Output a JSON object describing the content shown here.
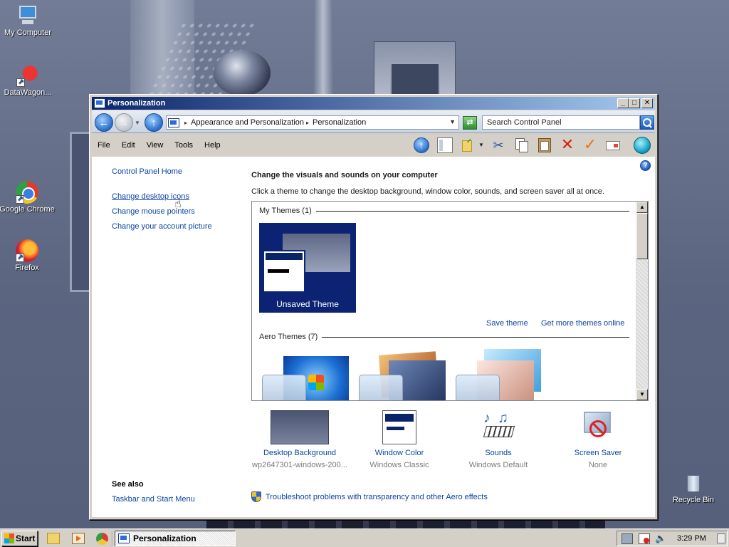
{
  "desktop": {
    "icons": [
      {
        "label": "My Computer"
      },
      {
        "label": "DataWagon..."
      },
      {
        "label": "Google Chrome"
      },
      {
        "label": "Firefox"
      },
      {
        "label": "Recycle Bin"
      }
    ]
  },
  "window": {
    "title": "Personalization",
    "address": {
      "breadcrumbs": [
        "Appearance and Personalization",
        "Personalization"
      ],
      "search_placeholder": "Search Control Panel"
    },
    "menu": [
      "File",
      "Edit",
      "View",
      "Tools",
      "Help"
    ],
    "left_nav": {
      "links": [
        "Control Panel Home",
        "Change desktop icons",
        "Change mouse pointers",
        "Change your account picture"
      ],
      "see_also_heading": "See also",
      "see_also_links": [
        "Taskbar and Start Menu"
      ]
    },
    "main": {
      "heading": "Change the visuals and sounds on your computer",
      "description": "Click a theme to change the desktop background, window color, sounds, and screen saver all at once.",
      "groups": [
        {
          "label": "My Themes (1)",
          "themes": [
            {
              "name": "Unsaved Theme",
              "selected": true
            }
          ]
        },
        {
          "label": "Aero Themes (7)",
          "themes": []
        }
      ],
      "save_theme": "Save theme",
      "more_themes": "Get more themes online",
      "options": [
        {
          "label": "Desktop Background",
          "value": "wp2647301-windows-200..."
        },
        {
          "label": "Window Color",
          "value": "Windows Classic"
        },
        {
          "label": "Sounds",
          "value": "Windows Default"
        },
        {
          "label": "Screen Saver",
          "value": "None"
        }
      ],
      "troubleshoot": "Troubleshoot problems with transparency and other Aero effects"
    }
  },
  "taskbar": {
    "start_label": "Start",
    "task_label": "Personalization",
    "clock": "3:29 PM"
  },
  "colors": {
    "link": "#0b45a4",
    "titlebar_start": "#0a246a",
    "titlebar_end": "#a6caf0",
    "selected_theme_bg": "#0c2272"
  }
}
